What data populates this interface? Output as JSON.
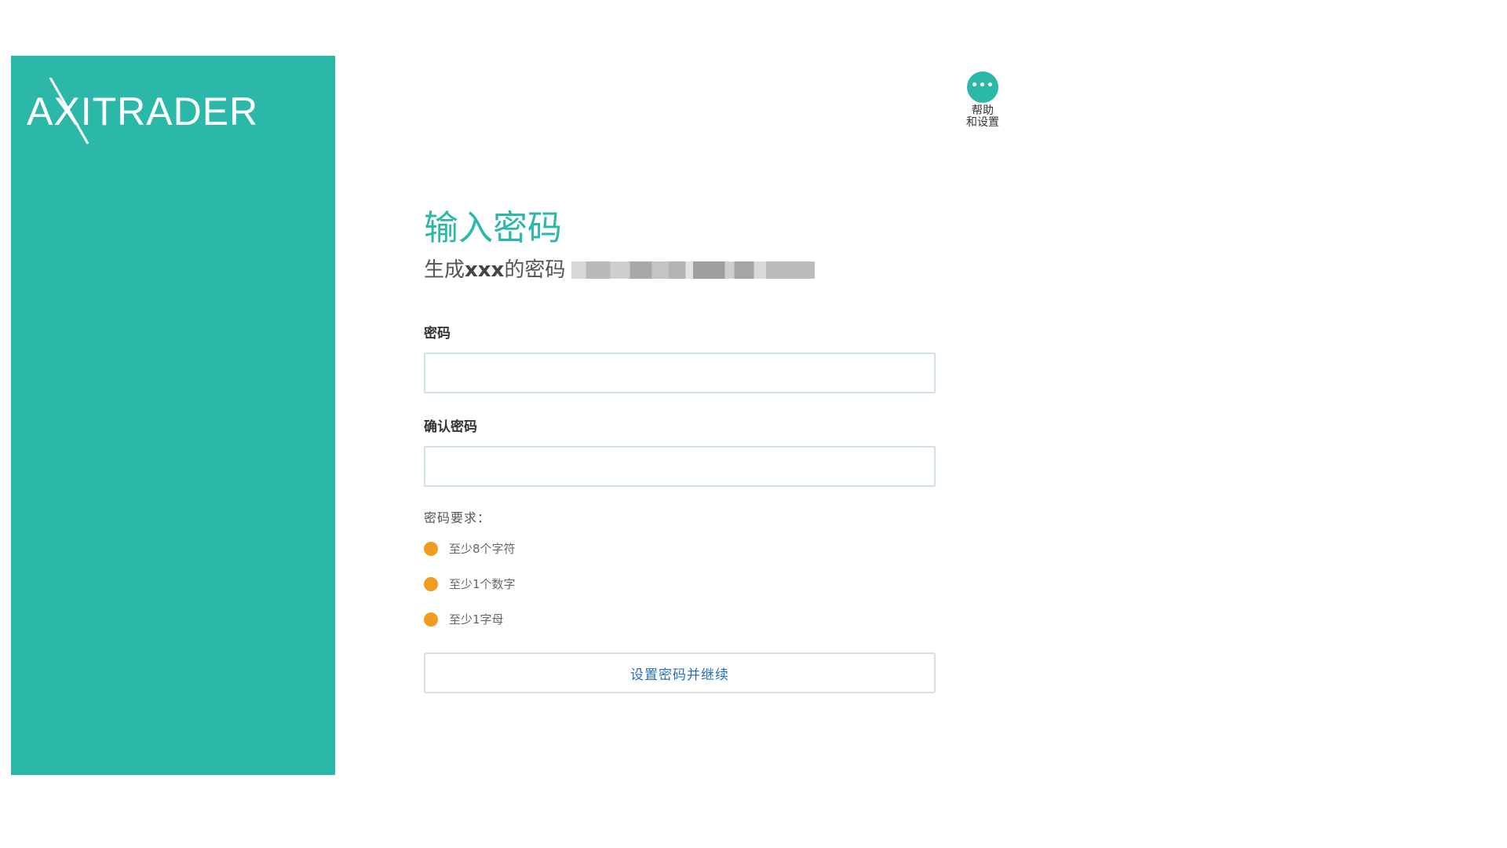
{
  "brand": {
    "logo_text": "AXITRADER",
    "color": "#2cb8a8"
  },
  "help": {
    "icon": "more-dots-icon",
    "glyph": "•••",
    "label": "帮助\n和设置"
  },
  "main": {
    "title": "输入密码",
    "subtitle_prefix": "生成",
    "subtitle_bold": "xxx",
    "subtitle_suffix": "的密码"
  },
  "form": {
    "password_label": "密码",
    "password_value": "",
    "confirm_label": "确认密码",
    "confirm_value": ""
  },
  "requirements": {
    "title": "密码要求：",
    "status_color": "#f39a21",
    "items": [
      {
        "text": "至少8个字符"
      },
      {
        "text": "至少1个数字"
      },
      {
        "text": "至少1字母"
      }
    ]
  },
  "submit": {
    "label": "设置密码并继续",
    "text_color": "#2a6fb5"
  }
}
